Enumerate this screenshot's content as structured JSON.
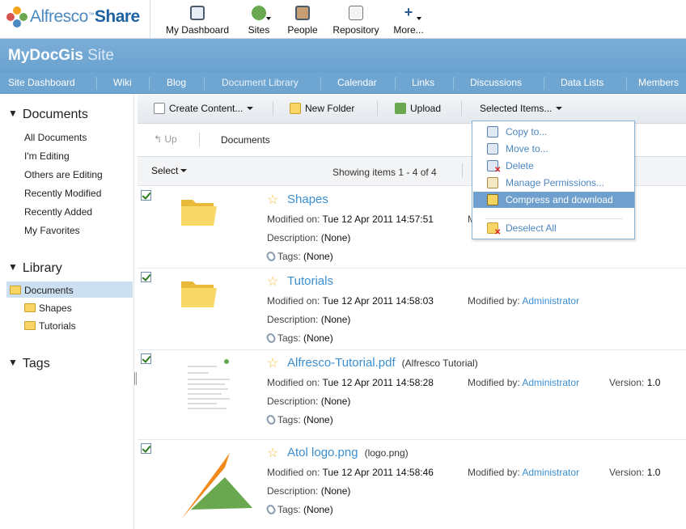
{
  "app": {
    "logo_text_1": "Alfresco",
    "logo_text_2": "Share"
  },
  "topnav": [
    {
      "label": "My Dashboard",
      "icon": "dashboard-icon"
    },
    {
      "label": "Sites",
      "icon": "sites-icon"
    },
    {
      "label": "People",
      "icon": "people-icon"
    },
    {
      "label": "Repository",
      "icon": "repository-icon"
    },
    {
      "label": "More...",
      "icon": "more-icon"
    }
  ],
  "site": {
    "name": "MyDocGis",
    "suffix": "Site"
  },
  "sitenav": [
    "Site Dashboard",
    "Wiki",
    "Blog",
    "Document Library",
    "Calendar",
    "Links",
    "Discussions",
    "Data Lists",
    "Members"
  ],
  "sidebar": {
    "documents_heading": "Documents",
    "filters": [
      "All Documents",
      "I'm Editing",
      "Others are Editing",
      "Recently Modified",
      "Recently Added",
      "My Favorites"
    ],
    "library_heading": "Library",
    "tree": {
      "root": "Documents",
      "children": [
        "Shapes",
        "Tutorials"
      ]
    },
    "tags_heading": "Tags"
  },
  "toolbar": {
    "create": "Create Content...",
    "new_folder": "New Folder",
    "upload": "Upload",
    "selected": "Selected Items..."
  },
  "path": {
    "up": "Up",
    "current": "Documents"
  },
  "listbar": {
    "select": "Select",
    "count": "Showing items 1 - 4 of 4"
  },
  "labels": {
    "modified_on": "Modified on:",
    "modified_by": "Modified by:",
    "description": "Description:",
    "tags": "Tags:",
    "version": "Version:"
  },
  "items": [
    {
      "name": "Shapes",
      "title": "",
      "modified_on": "Tue 12 Apr 2011 14:57:51",
      "modified_by": "",
      "version": "",
      "description": "(None)",
      "tags": "(None)"
    },
    {
      "name": "Tutorials",
      "title": "",
      "modified_on": "Tue 12 Apr 2011 14:58:03",
      "modified_by": "Administrator",
      "version": "",
      "description": "(None)",
      "tags": "(None)"
    },
    {
      "name": "Alfresco-Tutorial.pdf",
      "title": "(Alfresco Tutorial)",
      "modified_on": "Tue 12 Apr 2011 14:58:28",
      "modified_by": "Administrator",
      "version": "1.0",
      "description": "(None)",
      "tags": "(None)"
    },
    {
      "name": "Atol logo.png",
      "title": "(logo.png)",
      "modified_on": "Tue 12 Apr 2011 14:58:46",
      "modified_by": "Administrator",
      "version": "1.0",
      "description": "(None)",
      "tags": "(None)"
    }
  ],
  "menu": [
    "Copy to...",
    "Move to...",
    "Delete",
    "Manage Permissions...",
    "Compress and download",
    "Deselect All"
  ],
  "colors": {
    "header_blue": "#6ea5d1",
    "link_blue": "#3b8ed0",
    "highlight": "#6e9fcd"
  }
}
